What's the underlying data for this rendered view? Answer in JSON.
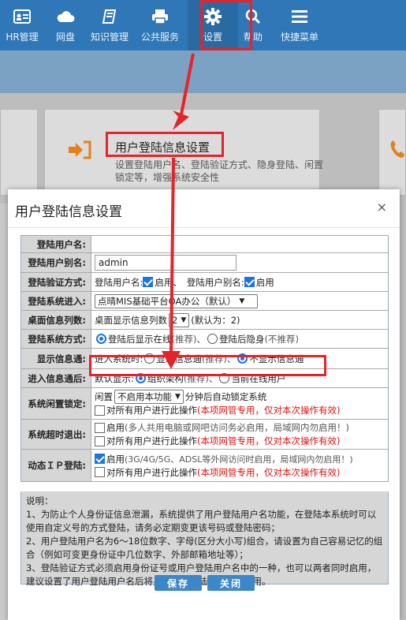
{
  "nav": {
    "items": [
      {
        "label": "HR管理",
        "icon": "id-card-icon"
      },
      {
        "label": "网盘",
        "icon": "cloud-icon"
      },
      {
        "label": "知识管理",
        "icon": "book-icon"
      },
      {
        "label": "公共服务",
        "icon": "printer-icon"
      },
      {
        "label": "设置",
        "icon": "gear-icon"
      },
      {
        "label": "帮助",
        "icon": "search-icon"
      },
      {
        "label": "快捷菜单",
        "icon": "menu-icon"
      }
    ],
    "active": "设置"
  },
  "background_card": {
    "title": "用户登陆信息设置",
    "desc": "设置登陆用户名、登陆验证方式、隐身登陆、闲置锁定等，增强系统安全性"
  },
  "dialog": {
    "title": "用户登陆信息设置",
    "close": "×",
    "rows": {
      "username": {
        "label": "登陆用户名:",
        "value": ""
      },
      "alias": {
        "label": "登陆用户别名:",
        "value": "admin"
      },
      "verify": {
        "label": "登陆验证方式:",
        "text1": "登陆用户名:",
        "opt1": "启用、",
        "text2": "登陆用户别名:",
        "opt2": "启用"
      },
      "system": {
        "label": "登陆系统进入:",
        "selected": "点晴MIS基础平台OA办公（默认）"
      },
      "desktop": {
        "label": "桌面信息列数:",
        "prefix": "桌面显示信息列数",
        "selected": "2",
        "suffix": "(默认为：2)"
      },
      "login_mode": {
        "label": "登陆系统方式:",
        "opt1": "登陆后显示在线",
        "opt1_note": "(推荐)、",
        "opt2": "登陆后隐身",
        "opt2_note": "(不推荐)"
      },
      "info_pass": {
        "label": "显示信息通:",
        "prefix": "进入系统时:",
        "opt1": "显示信息通",
        "opt1_note": "(推荐)、",
        "opt2": "不显示信息通"
      },
      "after_info": {
        "label": "进入信息通后:",
        "prefix": "默认显示:",
        "opt1": "组织架构",
        "opt1_note": "(推荐)、",
        "opt2": "当前在线用户"
      },
      "idle_lock": {
        "label": "系统闲置锁定:",
        "prefix": "闲置",
        "selected": "不启用本功能",
        "suffix": "分钟后自动锁定系统",
        "apply_all": "对所有用户进行此操作",
        "apply_note": "(本项网管专用，仅对本次操作有效)"
      },
      "timeout": {
        "label": "系统超时退出:",
        "enable": "启用",
        "enable_note": "(多人共用电脑或网吧访问务必启用，局域网内勿启用！)",
        "apply_all": "对所有用户进行此操作",
        "apply_note": "(本项网管专用，仅对本次操作有效)"
      },
      "dynamic_ip": {
        "label": "动态ＩＰ登陆:",
        "enable": "启用",
        "enable_note": "(3G/4G/5G、ADSL等外网访问时启用，局域网内勿启用！)",
        "apply_all": "对所有用户进行此操作",
        "apply_note": "(本项网管专用，仅对本次操作有效)"
      }
    },
    "notes": {
      "title": "说明：",
      "lines": [
        "1、为防止个人身份证信息泄漏，系统提供了用户登陆用户名功能，在登陆本系统时可以使用自定义号的方式登陆，请务必定期变更该号码或登陆密码；",
        "2、用户登陆用户名为6～18位数字、字母(区分大小写)组合，请设置为自己容易记忆的组合（例如可变更身份证中几位数字、外部邮箱地址等）；",
        "3、登陆验证方式必须启用身份证号或用户登陆用户名中的一种，也可以两者同时启用，建议设置了用户登陆用户名后将身份证号登陆验证方式禁用。"
      ]
    },
    "buttons": {
      "save": "保存",
      "close": "关闭"
    }
  },
  "colors": {
    "nav_bg": "#2f77b6",
    "annotation_red": "#e5232b",
    "button_blue": "#3c87c9",
    "warning_red": "#e01010"
  }
}
